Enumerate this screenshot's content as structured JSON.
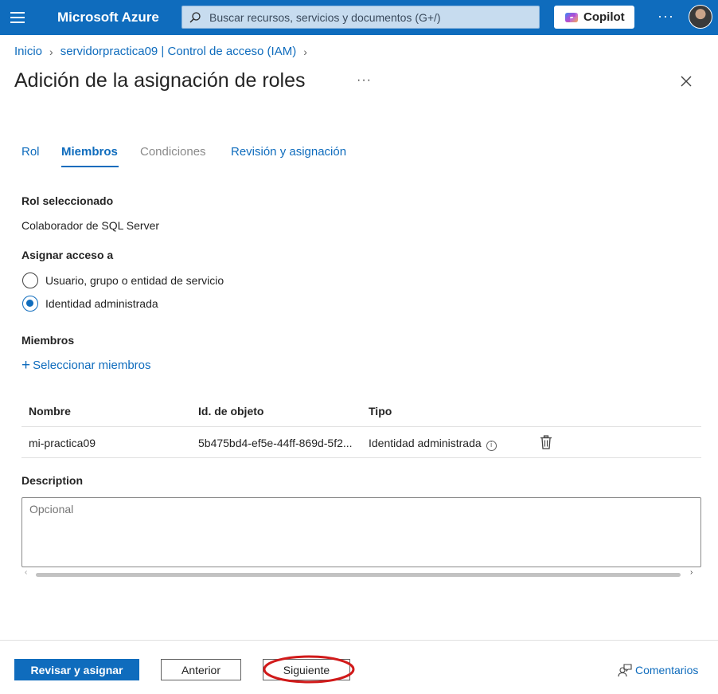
{
  "topbar": {
    "brand": "Microsoft Azure",
    "search_placeholder": "Buscar recursos, servicios y documentos (G+/)",
    "copilot_label": "Copilot",
    "more": "···"
  },
  "breadcrumb": {
    "items": [
      "Inicio",
      "servidorpractica09 | Control de acceso (IAM)"
    ]
  },
  "page": {
    "title": "Adición de la asignación de roles",
    "more": "···"
  },
  "tabs": [
    {
      "label": "Rol",
      "state": "link"
    },
    {
      "label": "Miembros",
      "state": "active"
    },
    {
      "label": "Condiciones",
      "state": "disabled"
    },
    {
      "label": "Revisión y asignación",
      "state": "link"
    }
  ],
  "role": {
    "heading": "Rol seleccionado",
    "value": "Colaborador de SQL Server"
  },
  "assign": {
    "heading": "Asignar acceso a",
    "options": [
      {
        "label": "Usuario, grupo o entidad de servicio",
        "checked": false
      },
      {
        "label": "Identidad administrada",
        "checked": true
      }
    ]
  },
  "members": {
    "heading": "Miembros",
    "select_link": "Seleccionar miembros",
    "columns": [
      "Nombre",
      "Id. de objeto",
      "Tipo"
    ],
    "rows": [
      {
        "name": "mi-practica09",
        "object_id": "5b475bd4-ef5e-44ff-869d-5f2...",
        "type": "Identidad administrada"
      }
    ]
  },
  "description": {
    "heading": "Description",
    "placeholder": "Opcional"
  },
  "footer": {
    "review_assign": "Revisar y asignar",
    "previous": "Anterior",
    "next": "Siguiente",
    "feedback": "Comentarios"
  },
  "colors": {
    "accent": "#0f6cbd",
    "highlight": "#d11a1a"
  }
}
